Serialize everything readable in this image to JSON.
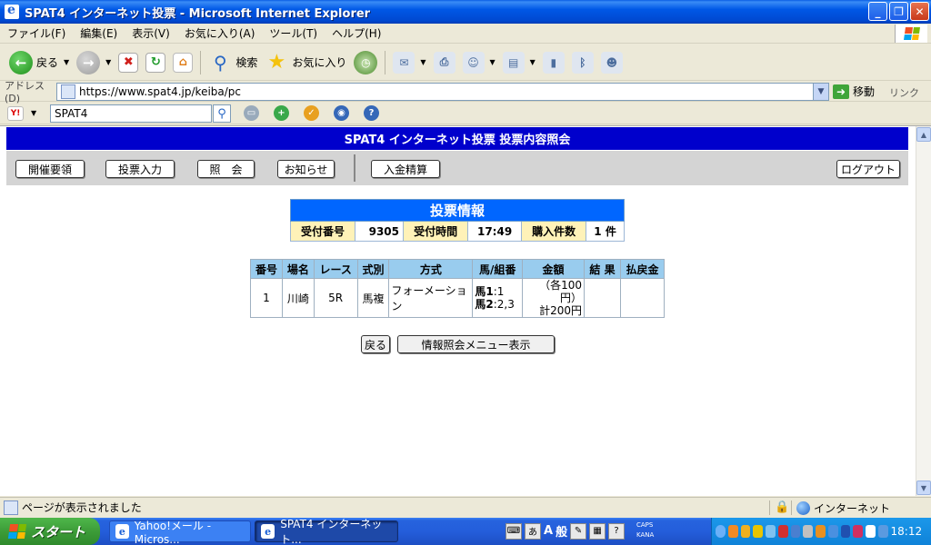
{
  "window": {
    "title": "SPAT4 インターネット投票 - Microsoft Internet Explorer",
    "controls": {
      "minimize": "_",
      "maximize": "❐",
      "close": "✕"
    }
  },
  "menubar": {
    "items": [
      "ファイル(F)",
      "編集(E)",
      "表示(V)",
      "お気に入り(A)",
      "ツール(T)",
      "ヘルプ(H)"
    ]
  },
  "toolbar": {
    "back_label": "戻る",
    "search_label": "検索",
    "favorites_label": "お気に入り"
  },
  "addressbar": {
    "label": "アドレス(D)",
    "url": "https://www.spat4.jp/keiba/pc",
    "go_label": "移動",
    "links_label": "リンク"
  },
  "searchbar": {
    "value": "SPAT4"
  },
  "page": {
    "header": "SPAT4 インターネット投票 投票内容照会",
    "nav": {
      "schedule": "開催要領",
      "vote_input": "投票入力",
      "inquiry": "照　会",
      "news": "お知らせ",
      "deposit": "入金精算",
      "logout": "ログアウト"
    },
    "ticket_info": {
      "title": "投票情報",
      "receipt_no_label": "受付番号",
      "receipt_no": "9305",
      "receipt_time_label": "受付時間",
      "receipt_time": "17:49",
      "count_label": "購入件数",
      "count": "1 件"
    },
    "bet_table": {
      "headers": [
        "番号",
        "場名",
        "レース",
        "式別",
        "方式",
        "馬/組番",
        "金額",
        "結 果",
        "払戻金"
      ],
      "rows": [
        {
          "no": "1",
          "venue": "川崎",
          "race": "5R",
          "bet_type": "馬複",
          "method": "フォーメーション",
          "horse1_label": "馬1",
          "horse1_value": ":1",
          "horse2_label": "馬2",
          "horse2_value": ":2,3",
          "amount_each": "（各100円）",
          "amount_total": "計200円",
          "result": "",
          "payout": ""
        }
      ]
    },
    "actions": {
      "back": "戻る",
      "menu": "情報照会メニュー表示"
    }
  },
  "statusbar": {
    "text": "ページが表示されました",
    "zone": "インターネット"
  },
  "taskbar": {
    "start": "スタート",
    "tasks": [
      "Yahoo!メール - Micros...",
      "SPAT4 インターネット..."
    ],
    "ime_mode": "般",
    "ime_a": "A",
    "caps": "CAPS",
    "kana": "KANA",
    "clock": "18:12"
  }
}
